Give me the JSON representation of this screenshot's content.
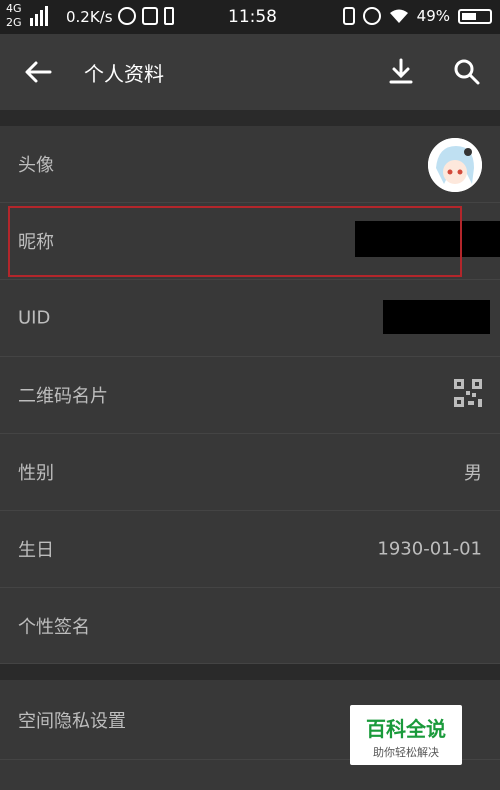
{
  "status_bar": {
    "network_top": "4G",
    "network_bottom": "2G",
    "speed": "0.2K/s",
    "time": "11:58",
    "battery": "49%"
  },
  "app_bar": {
    "title": "个人资料",
    "back_icon": "arrow-left-icon",
    "download_icon": "download-icon",
    "search_icon": "search-icon"
  },
  "rows": {
    "avatar": {
      "label": "头像"
    },
    "nickname": {
      "label": "昵称"
    },
    "uid": {
      "label": "UID"
    },
    "qr": {
      "label": "二维码名片",
      "icon": "qr-code-icon"
    },
    "gender": {
      "label": "性别",
      "value": "男"
    },
    "birthday": {
      "label": "生日",
      "value": "1930-01-01"
    },
    "signature": {
      "label": "个性签名"
    },
    "privacy": {
      "label": "空间隐私设置"
    },
    "cut_off": {
      "label": ""
    }
  },
  "watermark": {
    "main": "百科全说",
    "sub": "助你轻松解决"
  },
  "colors": {
    "background": "#2b2b2b",
    "row": "#383838",
    "app_bar": "#3a3a3a",
    "highlight_border": "#b3262b"
  }
}
